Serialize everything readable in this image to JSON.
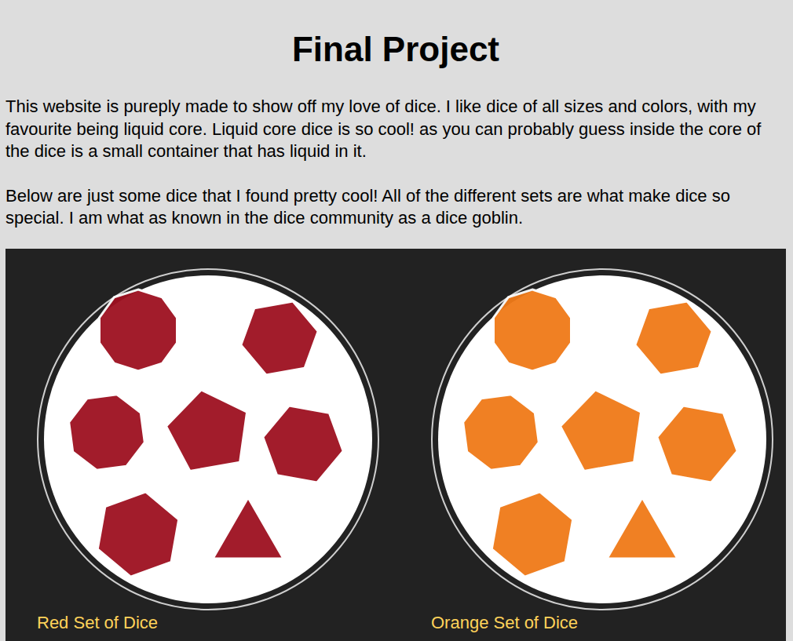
{
  "page": {
    "title": "Final Project",
    "paragraphs": [
      "This website is pureply made to show off my love of dice. I like dice of all sizes and colors, with my favourite being liquid core. Liquid core dice is so cool! as you can probably guess inside the core of the dice is a small container that has liquid in it.",
      "Below are just some dice that I found pretty cool! All of the different sets are what make dice so special. I am what as known in the dice community as a dice goblin."
    ]
  },
  "gallery": [
    {
      "caption": "Red Set of Dice",
      "color": "#9e1020"
    },
    {
      "caption": "Orange Set of Dice",
      "color": "#f07a18"
    }
  ]
}
